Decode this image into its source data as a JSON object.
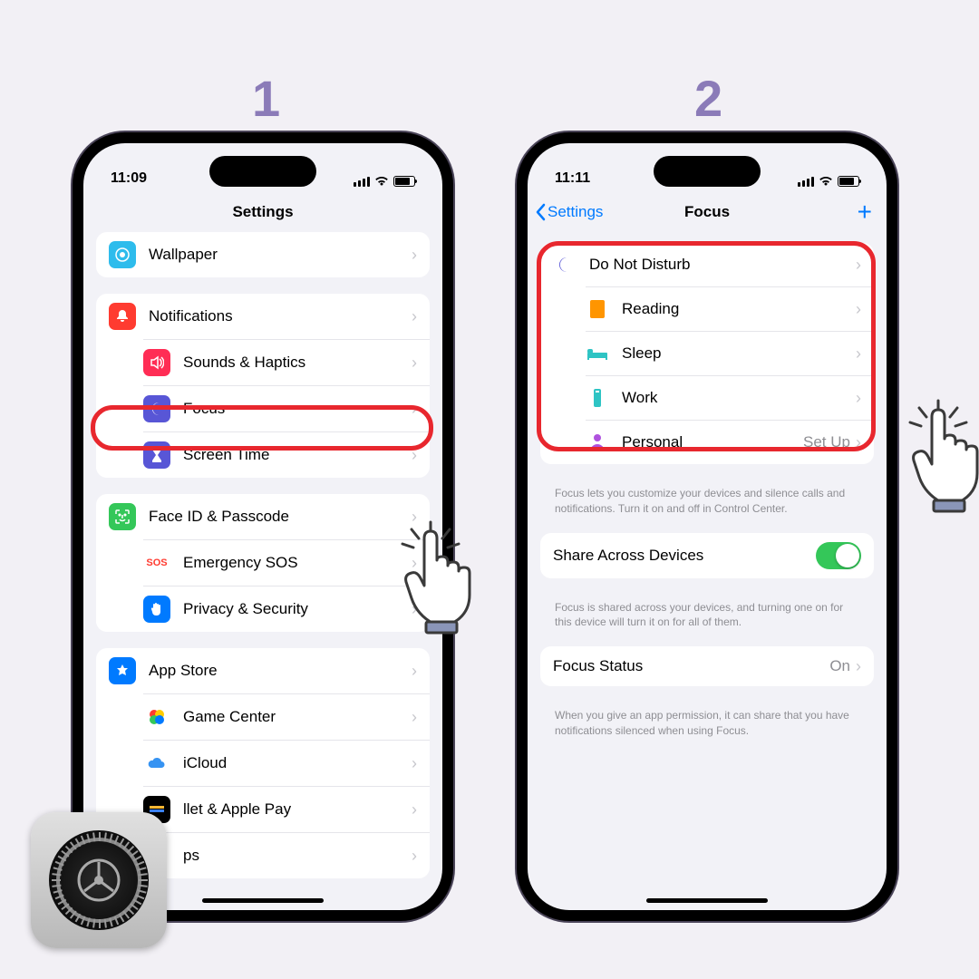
{
  "steps": [
    "1",
    "2"
  ],
  "phone1": {
    "time": "11:09",
    "title": "Settings",
    "sections": [
      [
        {
          "icon": "wallpaper",
          "color": "#2ebcec",
          "label": "Wallpaper"
        }
      ],
      [
        {
          "icon": "bell",
          "color": "#ff3b30",
          "label": "Notifications"
        },
        {
          "icon": "speaker",
          "color": "#ff2d55",
          "label": "Sounds & Haptics"
        },
        {
          "icon": "moon",
          "color": "#5856d6",
          "label": "Focus"
        },
        {
          "icon": "hourglass",
          "color": "#5856d6",
          "label": "Screen Time"
        }
      ],
      [
        {
          "icon": "faceid",
          "color": "#34c759",
          "label": "Face ID & Passcode"
        },
        {
          "icon": "sos",
          "color": "#ff3b30",
          "label": "Emergency SOS"
        },
        {
          "icon": "hand",
          "color": "#007aff",
          "label": "Privacy & Security"
        }
      ],
      [
        {
          "icon": "appstore",
          "color": "#007aff",
          "label": "App Store"
        },
        {
          "icon": "gamecenter",
          "color": "#fff",
          "label": "Game Center"
        },
        {
          "icon": "cloud",
          "color": "#fff",
          "label": "iCloud"
        },
        {
          "icon": "wallet",
          "color": "#000",
          "label": "    llet & Apple Pay"
        },
        {
          "icon": "",
          "color": "#fff",
          "label": "    ps"
        }
      ]
    ]
  },
  "phone2": {
    "time": "11:11",
    "back": "Settings",
    "title": "Focus",
    "modes": [
      {
        "icon": "🌙",
        "color": "#5856d6",
        "label": "Do Not Disturb",
        "detail": ""
      },
      {
        "icon": "📕",
        "color": "#ff9500",
        "label": "Reading",
        "detail": ""
      },
      {
        "icon": "🛏",
        "color": "#2ec4c4",
        "label": "Sleep",
        "detail": ""
      },
      {
        "icon": "💼",
        "color": "#2ec4c4",
        "label": "Work",
        "detail": ""
      },
      {
        "icon": "👤",
        "color": "#af52de",
        "label": "Personal",
        "detail": "Set Up"
      }
    ],
    "focusDesc": "Focus lets you customize your devices and silence calls and notifications. Turn it on and off in Control Center.",
    "shareLabel": "Share Across Devices",
    "shareDesc": "Focus is shared across your devices, and turning one on for this device will turn it on for all of them.",
    "statusLabel": "Focus Status",
    "statusValue": "On",
    "statusDesc": "When you give an app permission, it can share that you have notifications silenced when using Focus."
  }
}
